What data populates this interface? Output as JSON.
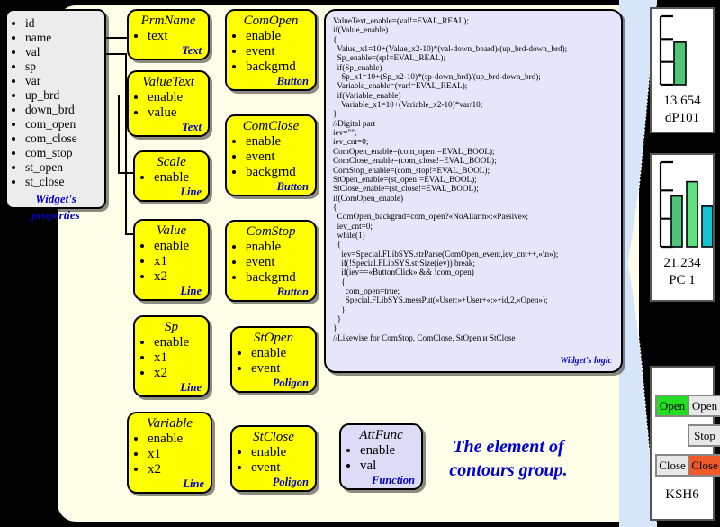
{
  "diagram": {
    "caption_line1": "The element of",
    "caption_line2": "contours group."
  },
  "properties_box": {
    "items": [
      "id",
      "name",
      "val",
      "sp",
      "var",
      "up_brd",
      "down_brd",
      "com_open",
      "com_close",
      "com_stop",
      "st_open",
      "st_close"
    ],
    "kind_line1": "Widget's",
    "kind_line2": "properties"
  },
  "nodes": [
    {
      "title": "PrmName",
      "items": [
        "text"
      ],
      "kind": "Text"
    },
    {
      "title": "ValueText",
      "items": [
        "enable",
        "value"
      ],
      "kind": "Text"
    },
    {
      "title": "Scale",
      "items": [
        "enable"
      ],
      "kind": "Line"
    },
    {
      "title": "Value",
      "items": [
        "enable",
        "x1",
        "x2"
      ],
      "kind": "Line"
    },
    {
      "title": "Sp",
      "items": [
        "enable",
        "x1",
        "x2"
      ],
      "kind": "Line"
    },
    {
      "title": "Variable",
      "items": [
        "enable",
        "x1",
        "x2"
      ],
      "kind": "Line"
    },
    {
      "title": "ComOpen",
      "items": [
        "enable",
        "event",
        "backgrnd"
      ],
      "kind": "Button"
    },
    {
      "title": "ComClose",
      "items": [
        "enable",
        "event",
        "backgrnd"
      ],
      "kind": "Button"
    },
    {
      "title": "ComStop",
      "items": [
        "enable",
        "event",
        "backgrnd"
      ],
      "kind": "Button"
    },
    {
      "title": "StOpen",
      "items": [
        "enable",
        "event"
      ],
      "kind": "Poligon"
    },
    {
      "title": "StClose",
      "items": [
        "enable",
        "event"
      ],
      "kind": "Poligon"
    },
    {
      "title": "AttFunc",
      "items": [
        "enable",
        "val"
      ],
      "kind": "Function"
    }
  ],
  "code": {
    "text": "ValueText_enable=(val!=EVAL_REAL);\nif(Value_enable)\n{\n  Value_x1=10+(Value_x2-10)*(val-down_board)/(up_brd-down_brd);\n  Sp_enable=(sp!=EVAL_REAL);\n  if(Sp_enable)\n    Sp_x1=10+(Sp_x2-10)*(sp-down_brd)/(up_brd-down_brd);\n  Variable_enable=(var!=EVAL_REAL);\n  if(Variable_enable)\n    Variable_x1=10+(Variable_x2-10)*var/10;\n}\n//Digital part\niev=\"\";\niev_cnt=0;\nComOpen_enable=(com_open!=EVAL_BOOL);\nComClose_enable=(com_close!=EVAL_BOOL);\nComStop_enable=(com_stop!=EVAL_BOOL);\nStOpen_enable=(st_open!=EVAL_BOOL);\nStClose_enable=(st_close!=EVAL_BOOL);\nif(ComOpen_enable)\n{\n  ComOpen_backgrnd=com_open?«NoAllarm»:«Passive»;\n  iev_cnt=0;\n  while(1)\n  {\n    iev=Special.FLibSYS.strParse(ComOpen_event,iev_cnt++,«\\n»);\n    if(!Special.FLibSYS.strSize(iev)) break;\n    if(iev==«ButtonClick» && !com_open)\n    {\n      com_open=true;\n      Special.FLibSYS.messPut(«User:»+User+«:»+id,2,«Open»);\n    }\n  }\n}\n//Likewise for ComStop, ComClose, StOpen и StClose",
    "kind": "Widget's logic"
  },
  "previews": {
    "gauge": {
      "name": "dP101",
      "value": "13.654",
      "bar_fraction": 0.62,
      "bar_color": "#4ec578",
      "ticks": 4
    },
    "bars": {
      "name": "PC 1",
      "value": "21.234",
      "series": [
        {
          "fraction": 0.6,
          "color": "#4ec578"
        },
        {
          "fraction": 0.77,
          "color": "#5de07d"
        },
        {
          "fraction": 0.48,
          "color": "#14c4d4"
        }
      ],
      "ticks": 4
    },
    "buttons": {
      "name": "KSH6",
      "items": [
        {
          "label": "Open",
          "color": "#22dd22",
          "row": 0,
          "col": 0
        },
        {
          "label": "Open",
          "color": "#e8e8e8",
          "row": 0,
          "col": 1
        },
        {
          "label": "Stop",
          "color": "#e8e8e8",
          "row": 1,
          "col": 1
        },
        {
          "label": "Close",
          "color": "#e8e8e8",
          "row": 2,
          "col": 0
        },
        {
          "label": "Close",
          "color": "#f05a28",
          "row": 2,
          "col": 1
        }
      ]
    }
  },
  "colors": {
    "node_yellow": "#ffff00",
    "node_grey": "#ececec",
    "node_lavender": "#dcdcf7",
    "panel_cream": "#fdfde8",
    "code_bg": "#e6e6fa",
    "wedge_blue": "#d6e6f8",
    "accent_blue": "#0000cc",
    "background": "#000000"
  }
}
